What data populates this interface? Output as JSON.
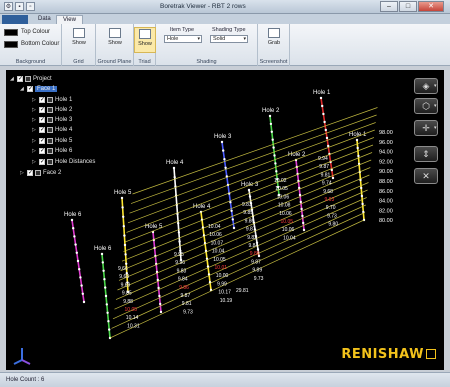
{
  "window": {
    "title": "Boretrak Viewer - RBT 2 rows",
    "minimize": "–",
    "maximize": "□",
    "close": "✕"
  },
  "tabs": [
    {
      "label": ""
    },
    {
      "label": "Data"
    },
    {
      "label": "View"
    }
  ],
  "ribbon": {
    "background": {
      "top_colour": "Top Colour",
      "bottom_colour": "Bottom Colour",
      "group_label": "Background"
    },
    "grid": {
      "show": "Show",
      "group_label": "Grid"
    },
    "ground_plane": {
      "show": "Show",
      "group_label": "Ground Plane"
    },
    "triad": {
      "show": "Show",
      "group_label": "Triad"
    },
    "shading": {
      "item_type_label": "Item Type",
      "item_type_value": "Hole",
      "shading_type_label": "Shading Type",
      "shading_type_value": "Solid",
      "group_label": "Shading"
    },
    "screenshot": {
      "grab": "Grab",
      "group_label": "Screenshot"
    }
  },
  "tree": {
    "project": "Project",
    "face1": "Face 1",
    "holes": [
      "Hole 1",
      "Hole 2",
      "Hole 3",
      "Hole 4",
      "Hole 5",
      "Hole 6"
    ],
    "hole_distances": "Hole Distances",
    "face2": "Face 2"
  },
  "scene": {
    "hole_labels": [
      "Hole 1",
      "Hole 1",
      "Hole 2",
      "Hole 2",
      "Hole 3",
      "Hole 3",
      "Hole 4",
      "Hole 4",
      "Hole 5",
      "Hole 5",
      "Hole 6",
      "Hole 6"
    ],
    "depth_labels": [
      "98.00",
      "96.00",
      "94.00",
      "92.00",
      "90.00",
      "88.00",
      "86.00",
      "84.00",
      "82.00",
      "80.00"
    ],
    "distance_values": [
      "9.94",
      "9.87",
      "9.81",
      "9.74",
      "9.68",
      "9.63",
      "9.70",
      "9.73",
      "9.80",
      "10.02",
      "10.05",
      "10.06",
      "10.08",
      "10.06",
      "10.05",
      "10.06",
      "10.04",
      "9.83",
      "9.85",
      "9.86",
      "9.87",
      "9.82",
      "9.84",
      "9.86",
      "9.87",
      "9.89",
      "9.73",
      "10.04",
      "10.06",
      "10.07",
      "10.04",
      "10.05",
      "10.01",
      "10.00",
      "9.99",
      "10.17",
      "10.19",
      "9.95",
      "9.96",
      "9.83",
      "9.84",
      "9.86",
      "9.87",
      "9.81",
      "9.73",
      "9.66",
      "9.68",
      "9.69",
      "9.85",
      "9.88",
      "10.05",
      "10.14",
      "10.31",
      "29.81"
    ]
  },
  "logo": "RENISHAW",
  "status": {
    "hole_count": "Hole Count : 6"
  }
}
